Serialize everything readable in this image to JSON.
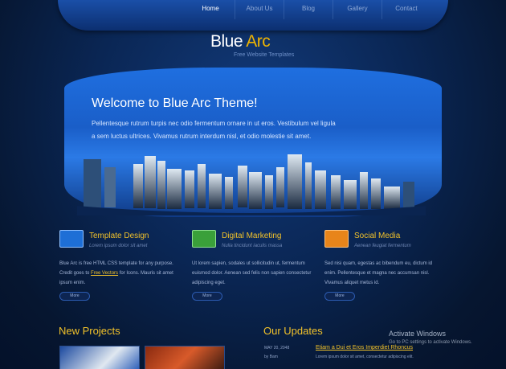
{
  "nav": {
    "items": [
      "Home",
      "About Us",
      "Blog",
      "Gallery",
      "Contact"
    ]
  },
  "logo": {
    "main": "Blue ",
    "accent": "Arc",
    "tagline": "Free Website Templates"
  },
  "hero": {
    "title": "Welcome to Blue Arc Theme!",
    "line1": "Pellentesque rutrum turpis nec odio fermentum ornare in ut eros. Vestibulum vel ligula",
    "line2": "a sem luctus ultrices. Vivamus rutrum interdum nisl, et odio molestie sit amet."
  },
  "features": [
    {
      "title": "Template Design",
      "sub": "Lorem ipsum dolor sit amet",
      "body_pre": "Blue Arc is free HTML CSS template for any purpose. Credit goes to ",
      "link": "Free Vectors",
      "body_post": " for Icons. Mauris sit amet ipsum enim.",
      "more": "More",
      "color": "#1e6fd6"
    },
    {
      "title": "Digital Marketing",
      "sub": "Nulla tincidunt iaculis massa",
      "body_pre": "Ut lorem sapien, sodales ut sollicitudin ut, fermentum euismod dolor. Aenean sed felis non sapien consectetur adipiscing eget.",
      "link": "",
      "body_post": "",
      "more": "More",
      "color": "#3aa03a"
    },
    {
      "title": "Social Media",
      "sub": "Aenean feugiat fermentum",
      "body_pre": "Sed nisi quam, egestas ac bibendum eu, dictum id enim. Pellentesque et magna nec accumsan nisl. Vivamus aliquet metus id.",
      "link": "",
      "body_post": "",
      "more": "More",
      "color": "#e8851a"
    }
  ],
  "projects": {
    "title": "New Projects"
  },
  "updates": {
    "title": "Our Updates",
    "date": "MAY 20, 2048",
    "by": "by Bam",
    "link": "Etiam a Dui et Eros Imperdiet Rhoncus",
    "text": "Lorem ipsum dolor sit amet, consectetur adipiscing elit."
  },
  "watermark": {
    "title": "Activate Windows",
    "sub": "Go to PC settings to activate Windows."
  }
}
